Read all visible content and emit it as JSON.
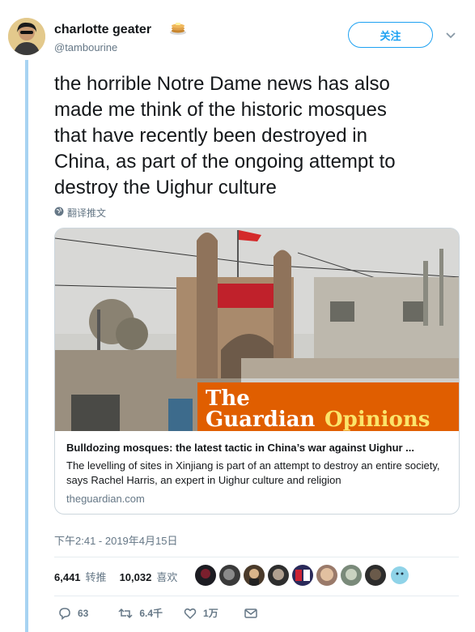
{
  "user": {
    "display_name": "charlotte geater",
    "handle": "@tambourine",
    "emoji_icon": "pancakes-icon"
  },
  "follow_button": {
    "label": "关注"
  },
  "tweet": {
    "text": "the horrible Notre Dame news has also\nmade me think of the historic mosques\nthat have recently been destroyed in\nChina, as part of the ongoing attempt to\ndestroy the Uighur culture",
    "translate_label": "翻译推文"
  },
  "card": {
    "image_brand": {
      "the": "The",
      "guardian": "Guardian",
      "opinions": "Opinions"
    },
    "title": "Bulldozing mosques: the latest tactic in China’s war against Uighur ...",
    "description": "The levelling of sites in Xinjiang is part of an attempt to destroy an entire society, says Rachel Harris, an expert in Uighur culture and religion",
    "domain": "theguardian.com"
  },
  "timestamp": "下午2:41 - 2019年4月15日",
  "stats": {
    "retweets_count": "6,441",
    "retweets_label": "转推",
    "likes_count": "10,032",
    "likes_label": "喜欢"
  },
  "actions": {
    "reply_count": "63",
    "retweet_count": "6.4千",
    "like_count": "1万"
  },
  "colors": {
    "accent": "#1da1f2",
    "guardian_orange": "#e05e00",
    "thread_line": "#a7d3f2"
  }
}
